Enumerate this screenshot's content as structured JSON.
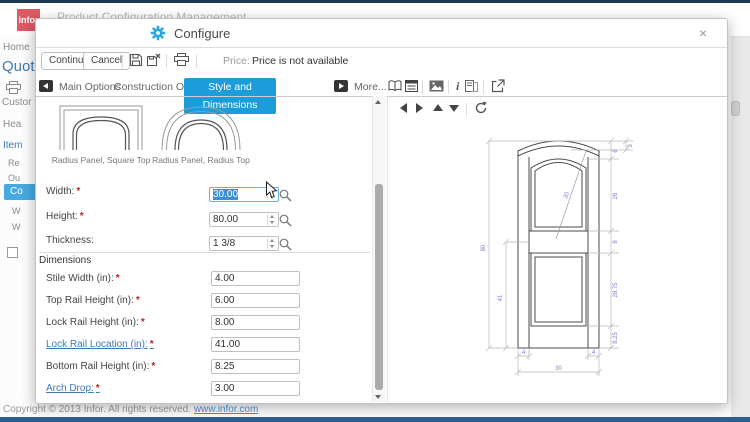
{
  "brand": {
    "logo_text": "infor"
  },
  "topbar": {
    "app_title": "Product Configuration Management"
  },
  "background": {
    "breadcrumb": "Home",
    "section_title": "Quote",
    "nav_fragments": [
      "Custor",
      "Hea",
      "Item",
      "Re",
      "Ou",
      "Co",
      "W",
      "W"
    ],
    "footer_copyright": "Copyright © 2013 Infor. All rights reserved.",
    "footer_link": "www.infor.com"
  },
  "modal": {
    "title": "Configure",
    "close_glyph": "×",
    "required_marker": "*",
    "toolbar": {
      "continue_label": "Continue",
      "cancel_label": "Cancel",
      "price_label": "Price:",
      "price_value": "Price is not available"
    },
    "tabs": {
      "items": [
        "Main Options",
        "Construction Options",
        "Style and Dimensions"
      ],
      "active_index": 2,
      "more_label": "More...",
      "info_glyph": "i"
    }
  },
  "form": {
    "thumbnails": [
      {
        "label": "Radius Panel, Square Top"
      },
      {
        "label": "Radius Panel, Radius Top"
      }
    ],
    "fields": [
      {
        "label": "Width:",
        "value": "30.00"
      },
      {
        "label": "Height:",
        "value": "80.00"
      },
      {
        "label": "Thickness:",
        "value": "1 3/8"
      }
    ],
    "dimensions_section": {
      "title": "Dimensions",
      "fields": [
        {
          "label": "Stile Width (in):",
          "value": "4.00"
        },
        {
          "label": "Top Rail Height (in):",
          "value": "6.00"
        },
        {
          "label": "Lock Rail Height (in):",
          "value": "8.00"
        },
        {
          "label": "Lock Rail Location (in):",
          "value": "41.00"
        },
        {
          "label": "Bottom Rail Height (in):",
          "value": "8.25"
        },
        {
          "label": "Arch Drop:",
          "value": "3.00"
        }
      ]
    }
  },
  "drawing": {
    "dims": {
      "door_height": "80",
      "lock_rail_location": "41",
      "top_rail": "6",
      "arch_drop": "3",
      "top_panel_height": "26",
      "lock_rail_height": "8",
      "bottom_panel_height": "28.75",
      "bottom_rail_height": "8.25",
      "stile_left": "4",
      "stile_right": "4",
      "door_width": "30",
      "diagonal": "30"
    }
  },
  "colors": {
    "accent_blue": "#1b9dd9",
    "infor_red": "#dd5a62",
    "selection_blue": "#3d8fd6",
    "link_blue": "#3e79b4",
    "dim_label": "#7b7bd0"
  }
}
